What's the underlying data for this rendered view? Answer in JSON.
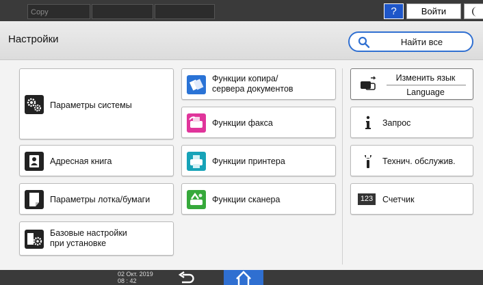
{
  "topbar": {
    "modes": [
      "Copy",
      "",
      ""
    ],
    "help_label": "?",
    "login_label": "Войти"
  },
  "header": {
    "title": "Настройки",
    "search_label": "Найти все"
  },
  "tiles": {
    "system": "Параметры системы",
    "copier_line1": "Функции копира/",
    "copier_line2": "сервера документов",
    "fax": "Функции факса",
    "printer": "Функции принтера",
    "scanner": "Функции сканера",
    "address_book": "Адресная книга",
    "tray_paper": "Параметры лотка/бумаги",
    "basic_line1": "Базовые настройки",
    "basic_line2": "при установке",
    "change_language": "Изменить язык",
    "language": "Language",
    "inquiry": "Запрос",
    "maintenance": "Технич. обслужив.",
    "counter": "Счетчик",
    "counter_icon_text": "123"
  },
  "bottombar": {
    "date": "02 Окт. 2019",
    "time": "08 : 42"
  },
  "colors": {
    "accent": "#2f6fd1",
    "bar": "#3a3a3a"
  }
}
